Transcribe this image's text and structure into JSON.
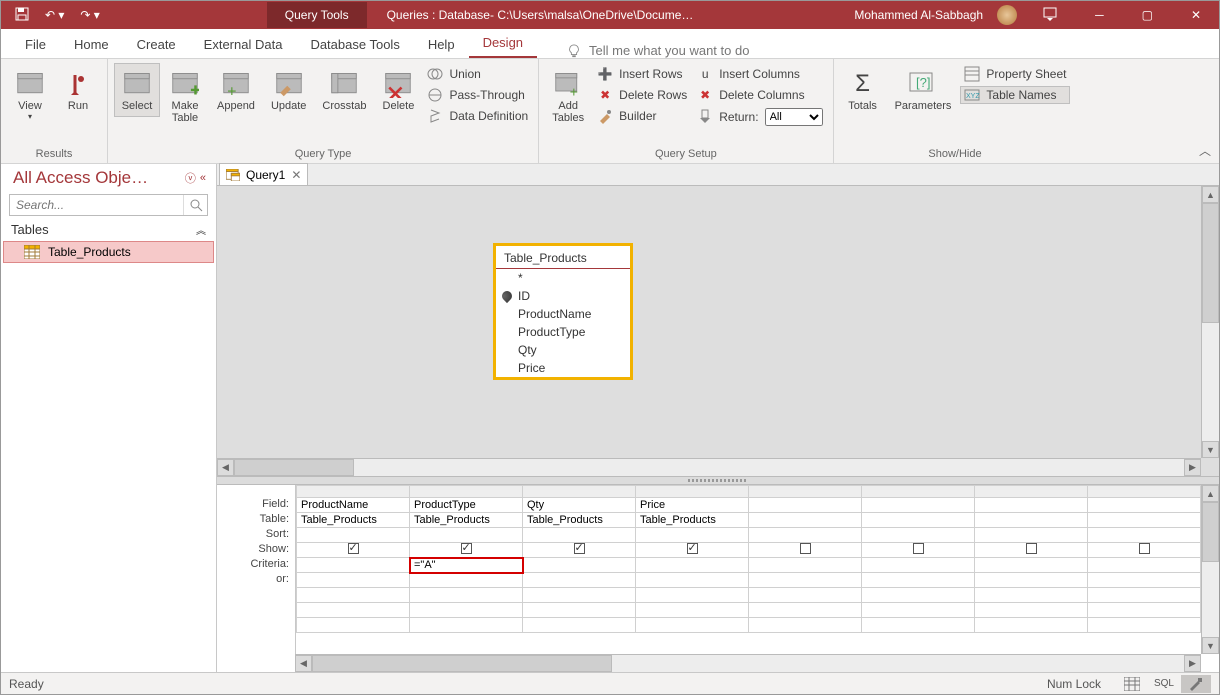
{
  "titlebar": {
    "tool_tab": "Query Tools",
    "doc_title": "Queries : Database- C:\\Users\\malsa\\OneDrive\\Docume…",
    "user": "Mohammed Al-Sabbagh"
  },
  "tabs": {
    "file": "File",
    "home": "Home",
    "create": "Create",
    "external": "External Data",
    "dbtools": "Database Tools",
    "help": "Help",
    "design": "Design",
    "tellme": "Tell me what you want to do"
  },
  "ribbon": {
    "results": {
      "label": "Results",
      "view": "View",
      "run": "Run"
    },
    "querytype": {
      "label": "Query Type",
      "select": "Select",
      "make": "Make\nTable",
      "append": "Append",
      "update": "Update",
      "crosstab": "Crosstab",
      "delete": "Delete",
      "union": "Union",
      "passthrough": "Pass-Through",
      "datadef": "Data Definition"
    },
    "setup": {
      "label": "Query Setup",
      "addtables": "Add\nTables",
      "insertrows": "Insert Rows",
      "deleterows": "Delete Rows",
      "builder": "Builder",
      "insertcols": "Insert Columns",
      "deletecols": "Delete Columns",
      "return": "Return:",
      "return_val": "All"
    },
    "showhide": {
      "label": "Show/Hide",
      "totals": "Totals",
      "params": "Parameters",
      "propsheet": "Property Sheet",
      "tablenames": "Table Names"
    }
  },
  "nav": {
    "title": "All Access Obje…",
    "search_placeholder": "Search...",
    "section": "Tables",
    "item": "Table_Products"
  },
  "doc": {
    "tab": "Query1"
  },
  "tablebox": {
    "title": "Table_Products",
    "fields": [
      "*",
      "ID",
      "ProductName",
      "ProductType",
      "Qty",
      "Price"
    ],
    "key_index": 1
  },
  "grid": {
    "rows": [
      "Field:",
      "Table:",
      "Sort:",
      "Show:",
      "Criteria:",
      "or:"
    ],
    "cols": [
      {
        "field": "ProductName",
        "table": "Table_Products",
        "show": true,
        "criteria": ""
      },
      {
        "field": "ProductType",
        "table": "Table_Products",
        "show": true,
        "criteria": "=\"A\""
      },
      {
        "field": "Qty",
        "table": "Table_Products",
        "show": true,
        "criteria": ""
      },
      {
        "field": "Price",
        "table": "Table_Products",
        "show": true,
        "criteria": ""
      },
      {
        "field": "",
        "table": "",
        "show": false,
        "criteria": ""
      },
      {
        "field": "",
        "table": "",
        "show": false,
        "criteria": ""
      },
      {
        "field": "",
        "table": "",
        "show": false,
        "criteria": ""
      },
      {
        "field": "",
        "table": "",
        "show": false,
        "criteria": ""
      }
    ],
    "criteria_highlight_col": 1
  },
  "status": {
    "ready": "Ready",
    "numlock": "Num Lock",
    "sql": "SQL"
  }
}
